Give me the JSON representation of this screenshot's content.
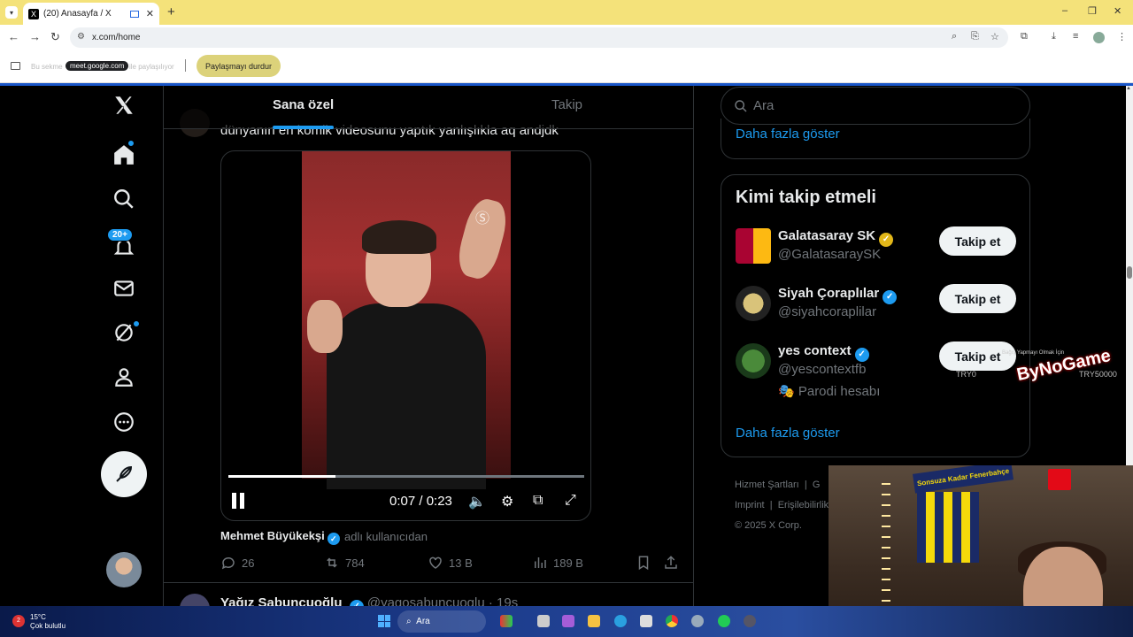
{
  "browser": {
    "tab_title": "(20) Anasayfa / X",
    "url": "x.com/home",
    "share_bar": {
      "text_before": "Bu sekme",
      "domain_pill": "meet.google.com",
      "text_after": "ile paylaşılıyor",
      "stop_button": "Paylaşmayı durdur"
    }
  },
  "nav": {
    "notifications_badge": "20+"
  },
  "timeline": {
    "tabs": [
      "Sana özel",
      "Takip"
    ],
    "tweet_text": "dünyanın en komik videosunu yaptık yanlışlıkla aq andjdk",
    "video": {
      "time": "0:07 / 0:23",
      "progress": 0.3
    },
    "author_name": "Mehmet Büyükekşi",
    "author_suffix": "adlı kullanıcıdan",
    "actions": {
      "replies": "26",
      "reposts": "784",
      "likes": "13 B",
      "views": "189 B"
    },
    "next_tweet": {
      "name": "Yağız Sabuncuoğlu",
      "handle": "@yagosabuncuoglu · 19s"
    }
  },
  "sidebar": {
    "search_placeholder": "Ara",
    "show_more": "Daha fazla göster",
    "who_to_follow_title": "Kimi takip etmeli",
    "follow_label": "Takip et",
    "suggestions": [
      {
        "name": "Galatasaray SK",
        "handle": "@GalatasaraySK",
        "check": "gold"
      },
      {
        "name": "Siyah Çoraplılar",
        "handle": "@siyahcoraplilar",
        "check": "blue"
      },
      {
        "name": "yes context",
        "handle": "@yescontextfb",
        "check": "blue",
        "parody": "🎭 Parodi hesabı"
      }
    ],
    "footer": {
      "terms": "Hizmet Şartları",
      "imprint": "Imprint",
      "accessibility": "Erişilebilirlik",
      "copyright": "© 2025 X Corp."
    }
  },
  "overlay": {
    "donation_tag": "Bağış Yapmayı Olmak İçin",
    "donation_brand": "ByNoGame",
    "donation_left": "TRY0",
    "donation_right": "TRY50000"
  },
  "webcam": {
    "scarf_text": "Sonsuza Kadar Fenerbahçe"
  },
  "taskbar": {
    "temperature": "15°C",
    "weather": "Çok bulutlu",
    "search": "Ara"
  },
  "colors": {
    "accent": "#1d9bf0",
    "background": "#000000",
    "text": "#e7e9ea",
    "muted": "#71767b",
    "gold_check": "#e2b719"
  }
}
